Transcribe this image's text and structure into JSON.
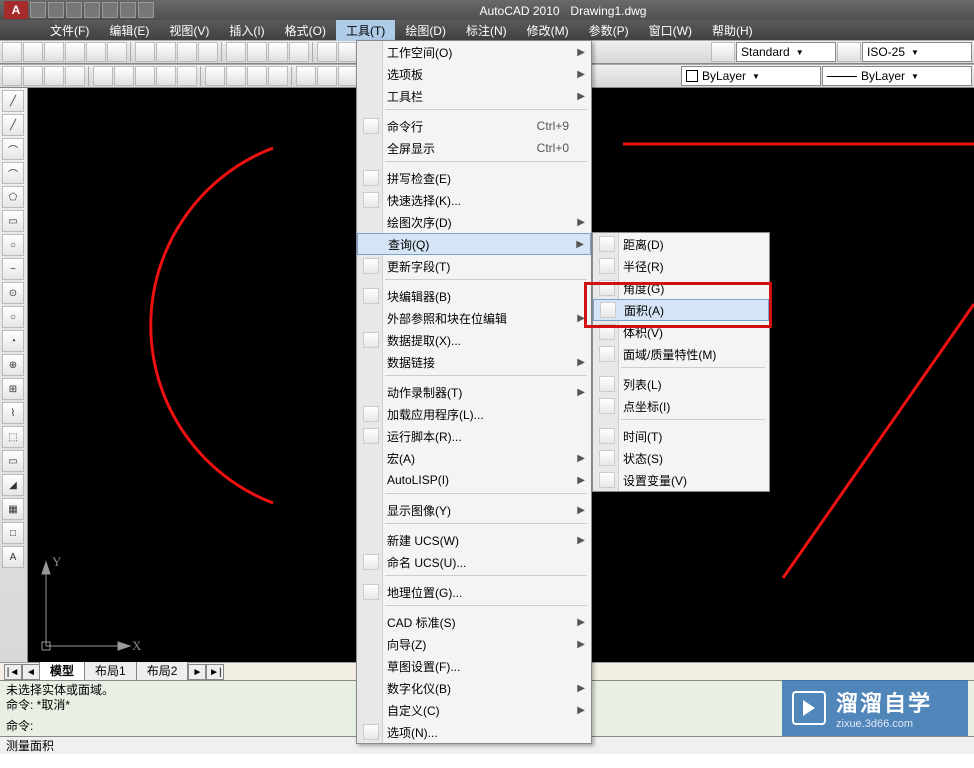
{
  "title": {
    "app": "AutoCAD 2010",
    "doc": "Drawing1.dwg"
  },
  "menubar": {
    "items": [
      {
        "l": "文件(F)"
      },
      {
        "l": "编辑(E)"
      },
      {
        "l": "视图(V)"
      },
      {
        "l": "插入(I)"
      },
      {
        "l": "格式(O)"
      },
      {
        "l": "工具(T)",
        "active": true
      },
      {
        "l": "绘图(D)"
      },
      {
        "l": "标注(N)"
      },
      {
        "l": "修改(M)"
      },
      {
        "l": "参数(P)"
      },
      {
        "l": "窗口(W)"
      },
      {
        "l": "帮助(H)"
      }
    ]
  },
  "toolbar2": {
    "style_label": "Standard",
    "iso_label": "ISO-25",
    "layer_label": "ByLayer",
    "layer_label2": "ByLayer"
  },
  "tools_menu": {
    "items": [
      {
        "l": "工作空间(O)",
        "arrow": true
      },
      {
        "l": "选项板",
        "arrow": true
      },
      {
        "l": "工具栏",
        "arrow": true
      },
      {
        "sep": true
      },
      {
        "l": "命令行",
        "shortcut": "Ctrl+9",
        "icon": true
      },
      {
        "l": "全屏显示",
        "shortcut": "Ctrl+0"
      },
      {
        "sep": true
      },
      {
        "l": "拼写检查(E)",
        "icon": true
      },
      {
        "l": "快速选择(K)...",
        "icon": true
      },
      {
        "l": "绘图次序(D)",
        "arrow": true
      },
      {
        "l": "查询(Q)",
        "arrow": true,
        "active": true
      },
      {
        "l": "更新字段(T)",
        "icon": true
      },
      {
        "sep": true
      },
      {
        "l": "块编辑器(B)",
        "icon": true
      },
      {
        "l": "外部参照和块在位编辑",
        "arrow": true
      },
      {
        "l": "数据提取(X)...",
        "icon": true
      },
      {
        "l": "数据链接",
        "arrow": true
      },
      {
        "sep": true
      },
      {
        "l": "动作录制器(T)",
        "arrow": true
      },
      {
        "l": "加载应用程序(L)...",
        "icon": true
      },
      {
        "l": "运行脚本(R)...",
        "icon": true
      },
      {
        "l": "宏(A)",
        "arrow": true
      },
      {
        "l": "AutoLISP(I)",
        "arrow": true
      },
      {
        "sep": true
      },
      {
        "l": "显示图像(Y)",
        "arrow": true
      },
      {
        "sep": true
      },
      {
        "l": "新建 UCS(W)",
        "arrow": true
      },
      {
        "l": "命名 UCS(U)...",
        "icon": true
      },
      {
        "sep": true
      },
      {
        "l": "地理位置(G)...",
        "icon": true
      },
      {
        "sep": true
      },
      {
        "l": "CAD 标准(S)",
        "arrow": true
      },
      {
        "l": "向导(Z)",
        "arrow": true
      },
      {
        "l": "草图设置(F)..."
      },
      {
        "l": "数字化仪(B)",
        "arrow": true
      },
      {
        "l": "自定义(C)",
        "arrow": true
      },
      {
        "l": "选项(N)...",
        "icon": true
      }
    ]
  },
  "inquiry_submenu": {
    "items": [
      {
        "l": "距离(D)",
        "icon": true
      },
      {
        "l": "半径(R)",
        "icon": true
      },
      {
        "l": "角度(G)",
        "icon": true
      },
      {
        "l": "面积(A)",
        "icon": true,
        "active": true
      },
      {
        "l": "体积(V)",
        "icon": true
      },
      {
        "l": "面域/质量特性(M)",
        "icon": true
      },
      {
        "sep": true
      },
      {
        "l": "列表(L)",
        "icon": true
      },
      {
        "l": "点坐标(I)",
        "icon": true
      },
      {
        "sep": true
      },
      {
        "l": "时间(T)",
        "icon": true
      },
      {
        "l": "状态(S)",
        "icon": true
      },
      {
        "l": "设置变量(V)",
        "icon": true
      }
    ]
  },
  "side_tools": [
    "╱",
    "╱",
    "⌒",
    "⌒",
    "⬠",
    "▭",
    "○",
    "~",
    "⊙",
    "○",
    "◔",
    "⊕",
    "⊞",
    "⌇",
    "⬚",
    "▭",
    "◢",
    "▦",
    "□",
    "A"
  ],
  "tabs": {
    "prev": "◄",
    "next": "►",
    "first": "|◄",
    "last": "►|",
    "items": [
      {
        "l": "模型",
        "active": true
      },
      {
        "l": "布局1"
      },
      {
        "l": "布局2"
      }
    ]
  },
  "cmd": {
    "line1": "未选择实体或面域。",
    "line2": "命令: *取消*",
    "line3": "命令:"
  },
  "status": {
    "text": "测量面积"
  },
  "ucs": {
    "x": "X",
    "y": "Y"
  },
  "watermark": {
    "brand": "溜溜自学",
    "url": "zixue.3d66.com"
  }
}
